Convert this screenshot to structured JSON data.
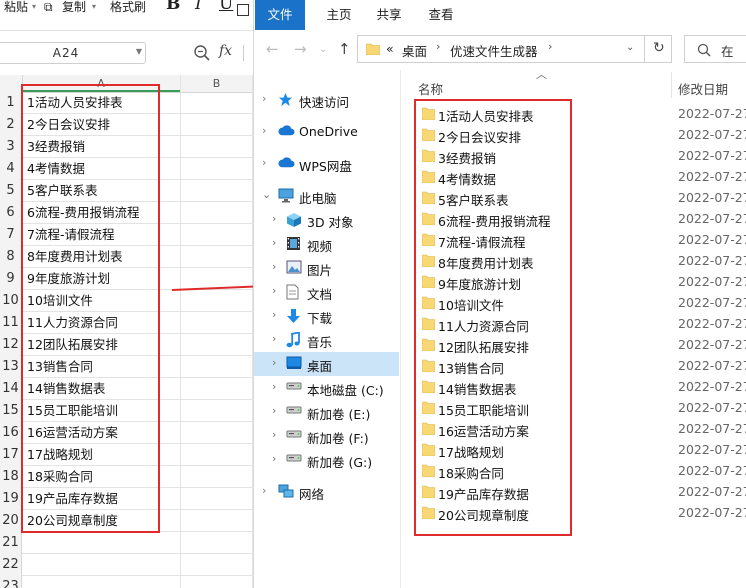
{
  "spreadsheet": {
    "toolbar": {
      "paste_label": "粘贴",
      "copy_label": "复制",
      "format_brush_label": "格式刷",
      "bold_label": "B",
      "italic_label": "I",
      "underline_label": "U"
    },
    "name_box_value": "A24",
    "formula_label": "fx",
    "column_headers": [
      "A",
      "B"
    ],
    "rows": [
      {
        "num": "1",
        "a": "1活动人员安排表"
      },
      {
        "num": "2",
        "a": "2今日会议安排"
      },
      {
        "num": "3",
        "a": "3经费报销"
      },
      {
        "num": "4",
        "a": "4考情数据"
      },
      {
        "num": "5",
        "a": "5客户联系表"
      },
      {
        "num": "6",
        "a": "6流程-费用报销流程"
      },
      {
        "num": "7",
        "a": "7流程-请假流程"
      },
      {
        "num": "8",
        "a": "8年度费用计划表"
      },
      {
        "num": "9",
        "a": "9年度旅游计划"
      },
      {
        "num": "10",
        "a": "10培训文件"
      },
      {
        "num": "11",
        "a": "11人力资源合同"
      },
      {
        "num": "12",
        "a": "12团队拓展安排"
      },
      {
        "num": "13",
        "a": "13销售合同"
      },
      {
        "num": "14",
        "a": "14销售数据表"
      },
      {
        "num": "15",
        "a": "15员工职能培训"
      },
      {
        "num": "16",
        "a": "16运营活动方案"
      },
      {
        "num": "17",
        "a": "17战略规划"
      },
      {
        "num": "18",
        "a": "18采购合同"
      },
      {
        "num": "19",
        "a": "19产品库存数据"
      },
      {
        "num": "20",
        "a": "20公司规章制度"
      },
      {
        "num": "21",
        "a": ""
      },
      {
        "num": "22",
        "a": ""
      },
      {
        "num": "23",
        "a": ""
      }
    ]
  },
  "explorer": {
    "ribbon_tabs": [
      "文件",
      "主页",
      "共享",
      "查看"
    ],
    "breadcrumb": {
      "overflow": "«",
      "parts": [
        "桌面",
        "优速文件生成器"
      ]
    },
    "search_placeholder": "在",
    "nav_items": [
      {
        "label": "快速访问",
        "icon": "star-icon"
      },
      {
        "label": "OneDrive",
        "icon": "cloud-icon"
      },
      {
        "label": "WPS网盘",
        "icon": "cloud-icon"
      },
      {
        "label": "此电脑",
        "icon": "computer-icon"
      },
      {
        "label": "3D 对象",
        "icon": "cube-icon"
      },
      {
        "label": "视频",
        "icon": "film-icon"
      },
      {
        "label": "图片",
        "icon": "picture-icon"
      },
      {
        "label": "文档",
        "icon": "document-icon"
      },
      {
        "label": "下载",
        "icon": "download-icon"
      },
      {
        "label": "音乐",
        "icon": "music-icon"
      },
      {
        "label": "桌面",
        "icon": "desktop-icon"
      },
      {
        "label": "本地磁盘 (C:)",
        "icon": "drive-icon"
      },
      {
        "label": "新加卷 (E:)",
        "icon": "drive-icon"
      },
      {
        "label": "新加卷 (F:)",
        "icon": "drive-icon"
      },
      {
        "label": "新加卷 (G:)",
        "icon": "drive-icon"
      },
      {
        "label": "网络",
        "icon": "network-icon"
      }
    ],
    "columns": {
      "name": "名称",
      "date": "修改日期"
    },
    "files": [
      {
        "name": "1活动人员安排表",
        "date": "2022-07-27"
      },
      {
        "name": "2今日会议安排",
        "date": "2022-07-27"
      },
      {
        "name": "3经费报销",
        "date": "2022-07-27"
      },
      {
        "name": "4考情数据",
        "date": "2022-07-27"
      },
      {
        "name": "5客户联系表",
        "date": "2022-07-27"
      },
      {
        "name": "6流程-费用报销流程",
        "date": "2022-07-27"
      },
      {
        "name": "7流程-请假流程",
        "date": "2022-07-27"
      },
      {
        "name": "8年度费用计划表",
        "date": "2022-07-27"
      },
      {
        "name": "9年度旅游计划",
        "date": "2022-07-27"
      },
      {
        "name": "10培训文件",
        "date": "2022-07-27"
      },
      {
        "name": "11人力资源合同",
        "date": "2022-07-27"
      },
      {
        "name": "12团队拓展安排",
        "date": "2022-07-27"
      },
      {
        "name": "13销售合同",
        "date": "2022-07-27"
      },
      {
        "name": "14销售数据表",
        "date": "2022-07-27"
      },
      {
        "name": "15员工职能培训",
        "date": "2022-07-27"
      },
      {
        "name": "16运营活动方案",
        "date": "2022-07-27"
      },
      {
        "name": "17战略规划",
        "date": "2022-07-27"
      },
      {
        "name": "18采购合同",
        "date": "2022-07-27"
      },
      {
        "name": "19产品库存数据",
        "date": "2022-07-27"
      },
      {
        "name": "20公司规章制度",
        "date": "2022-07-27"
      }
    ]
  },
  "colors": {
    "highlight_red": "#e02b2b",
    "file_tab_blue": "#1a73c8",
    "selected_nav": "#cce4f7",
    "folder_yellow": "#f8d775",
    "sheet_accent_green": "#3a9b5a"
  }
}
